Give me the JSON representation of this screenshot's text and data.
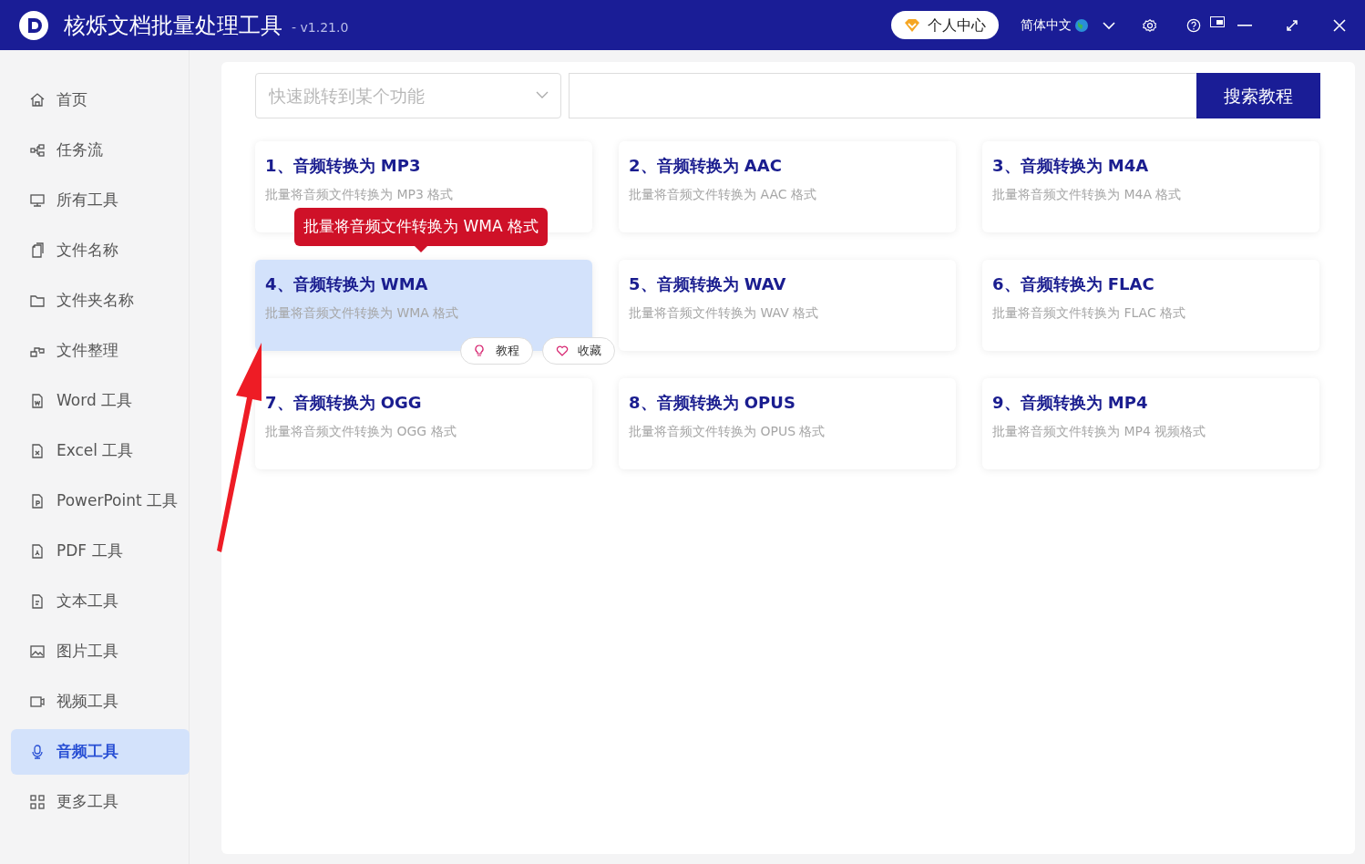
{
  "window": {
    "title": "核烁文档批量处理工具",
    "version": "- v1.21.0"
  },
  "header": {
    "account_button": "个人中心",
    "language": "简体中文"
  },
  "sidebar": {
    "items": [
      {
        "label": "首页",
        "selected": false
      },
      {
        "label": "任务流",
        "selected": false
      },
      {
        "label": "所有工具",
        "selected": false
      },
      {
        "label": "文件名称",
        "selected": false
      },
      {
        "label": "文件夹名称",
        "selected": false
      },
      {
        "label": "文件整理",
        "selected": false
      },
      {
        "label": "Word 工具",
        "selected": false
      },
      {
        "label": "Excel 工具",
        "selected": false
      },
      {
        "label": "PowerPoint 工具",
        "selected": false
      },
      {
        "label": "PDF 工具",
        "selected": false
      },
      {
        "label": "文本工具",
        "selected": false
      },
      {
        "label": "图片工具",
        "selected": false
      },
      {
        "label": "视频工具",
        "selected": false
      },
      {
        "label": "音频工具",
        "selected": true
      },
      {
        "label": "更多工具",
        "selected": false
      }
    ]
  },
  "search": {
    "jump_placeholder": "快速跳转到某个功能",
    "button": "搜索教程"
  },
  "cards": [
    {
      "title": "1、音频转换为 MP3",
      "description": "批量将音频文件转换为 MP3 格式",
      "selected": false
    },
    {
      "title": "2、音频转换为 AAC",
      "description": "批量将音频文件转换为 AAC 格式",
      "selected": false
    },
    {
      "title": "3、音频转换为 M4A",
      "description": "批量将音频文件转换为 M4A 格式",
      "selected": false
    },
    {
      "title": "4、音频转换为 WMA",
      "description": "批量将音频文件转换为 WMA 格式",
      "selected": true,
      "tooltip": "批量将音频文件转换为 WMA 格式",
      "actions": [
        "教程",
        "收藏"
      ]
    },
    {
      "title": "5、音频转换为 WAV",
      "description": "批量将音频文件转换为 WAV 格式",
      "selected": false
    },
    {
      "title": "6、音频转换为 FLAC",
      "description": "批量将音频文件转换为 FLAC 格式",
      "selected": false
    },
    {
      "title": "7、音频转换为 OGG",
      "description": "批量将音频文件转换为 OGG 格式",
      "selected": false
    },
    {
      "title": "8、音频转换为 OPUS",
      "description": "批量将音频文件转换为 OPUS 格式",
      "selected": false
    },
    {
      "title": "9、音频转换为 MP4",
      "description": "批量将音频文件转换为 MP4 视频格式",
      "selected": false
    }
  ]
}
